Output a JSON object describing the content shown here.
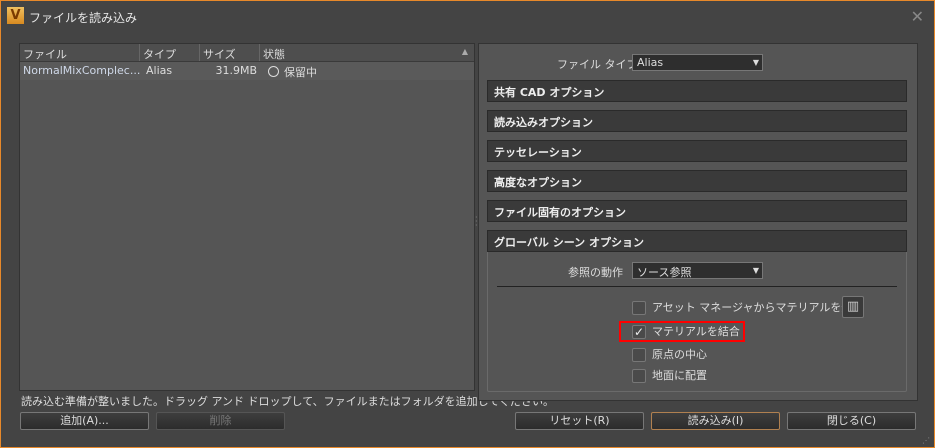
{
  "window": {
    "title": "ファイルを読み込み",
    "logo": "V",
    "close": "✕"
  },
  "file_list": {
    "columns": [
      "ファイル",
      "タイプ",
      "サイズ",
      "状態"
    ],
    "rows": [
      {
        "file": "NormalMixComplec...",
        "type": "Alias",
        "size": "31.9MB",
        "status": "保留中"
      }
    ]
  },
  "status_text": "読み込む準備が整いました。ドラッグ アンド ドロップして、ファイルまたはフォルダを追加してください。",
  "buttons": {
    "add": "追加(A)...",
    "delete": "削除",
    "reset": "リセット(R)",
    "import": "読み込み(I)",
    "close": "閉じる(C)"
  },
  "file_type": {
    "label": "ファイル タイプ",
    "value": "Alias"
  },
  "sections": [
    "共有 CAD オプション",
    "読み込みオプション",
    "テッセレーション",
    "高度なオプション",
    "ファイル固有のオプション",
    "グローバル シーン オプション"
  ],
  "global": {
    "ref_label": "参照の動作",
    "ref_value": "ソース参照",
    "options": [
      {
        "label": "アセット マネージャからマテリアルを適用",
        "checked": false
      },
      {
        "label": "マテリアルを結合",
        "checked": true
      },
      {
        "label": "原点の中心",
        "checked": false
      },
      {
        "label": "地面に配置",
        "checked": false
      }
    ]
  },
  "colors": {
    "accent": "#e8892a",
    "highlight": "#ff0000"
  }
}
